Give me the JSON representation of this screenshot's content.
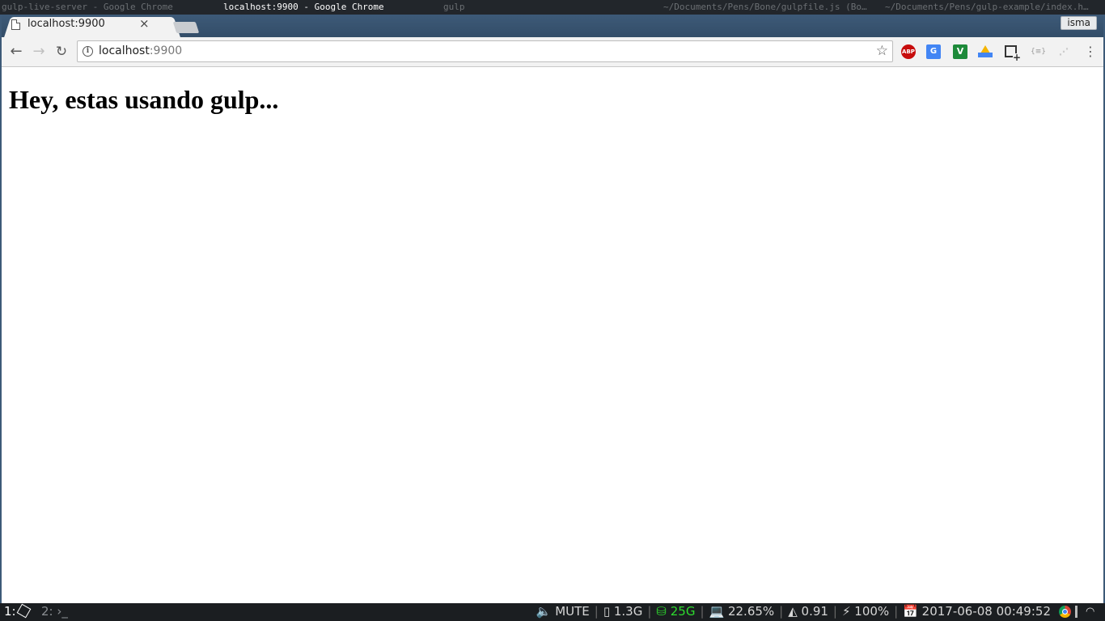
{
  "wm": {
    "titles": [
      "gulp-live-server - Google Chrome",
      "localhost:9900 - Google Chrome",
      "gulp",
      "~/Documents/Pens/Bone/gulpfile.js (Bo…",
      "~/Documents/Pens/gulp-example/index.h…"
    ]
  },
  "chrome": {
    "tab": {
      "title": "localhost:9900",
      "close": "×"
    },
    "profile": "isma",
    "nav": {
      "back": "←",
      "forward": "→",
      "reload": "↻"
    },
    "omnibox": {
      "host": "localhost",
      "port": ":9900",
      "info": "i",
      "star": "☆"
    },
    "extensions": {
      "abp": "ABP",
      "translate": "G",
      "v": "V",
      "json": "{≡}",
      "misc": "⋰"
    },
    "menu": "⋮"
  },
  "page": {
    "heading": "Hey, estas usando gulp..."
  },
  "statusbar": {
    "ws1": "1:",
    "ws2": "2: ›_",
    "volume": "🔈 MUTE",
    "memory": "▯ 1.3G",
    "disk": "⛁ 25G",
    "cpu": "💻 22.65%",
    "load": "◭ 0.91",
    "battery": "⚡ 100%",
    "datetime": "📅 2017-06-08 00:49:52",
    "wifi": "◠"
  }
}
